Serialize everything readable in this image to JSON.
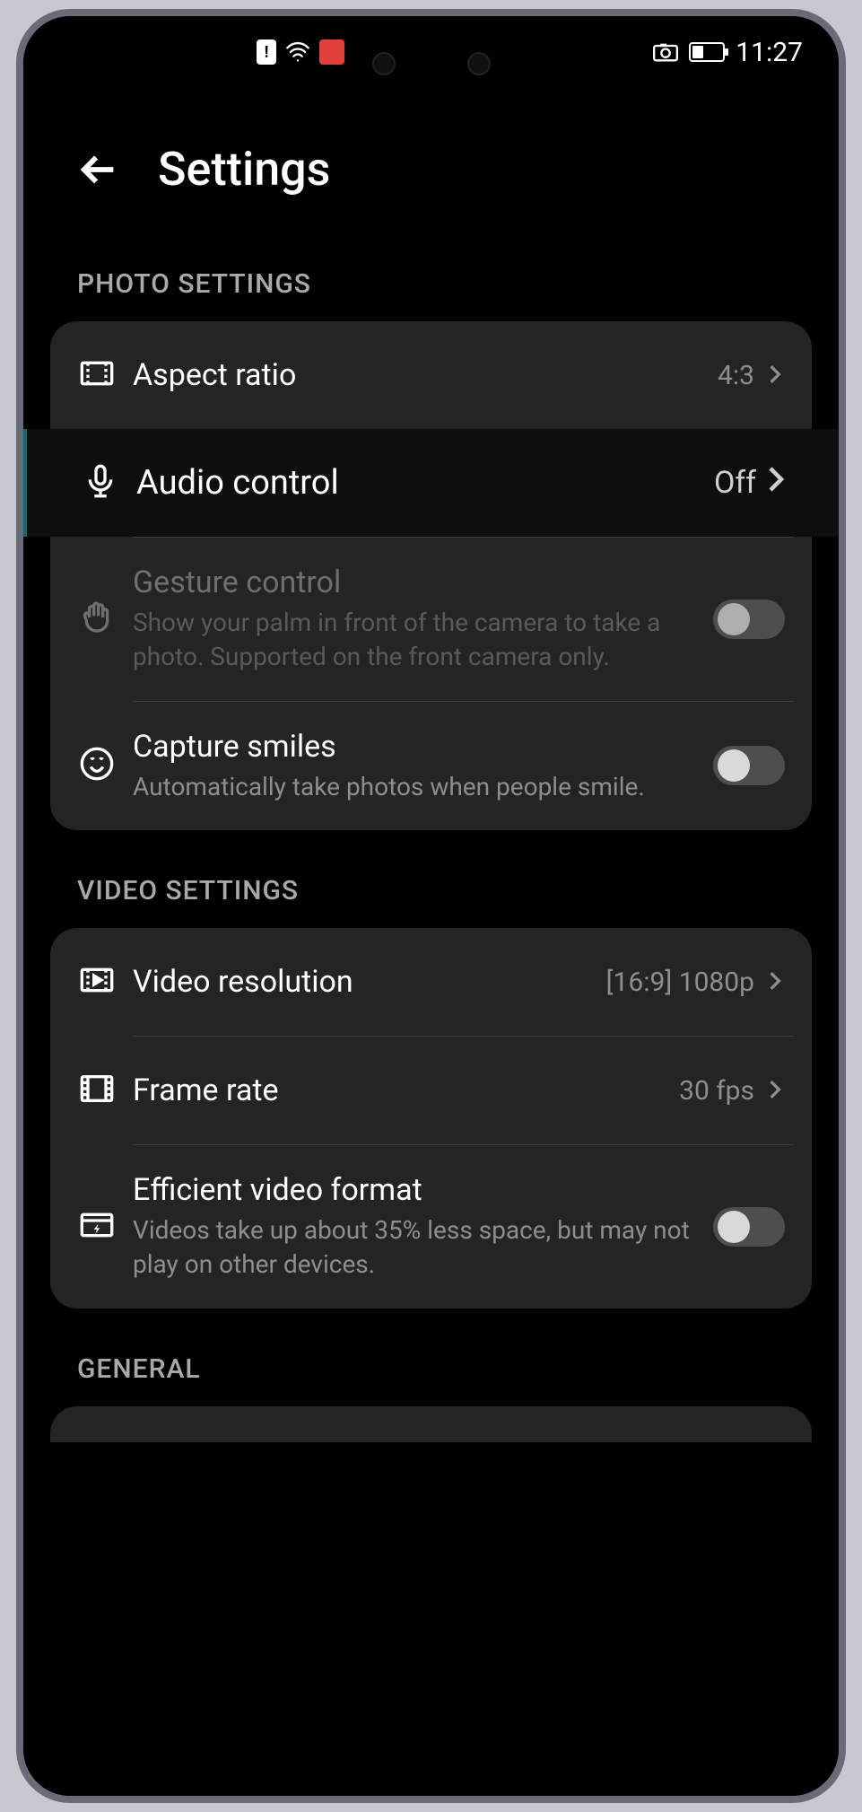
{
  "status": {
    "time": "11:27"
  },
  "header": {
    "title": "Settings"
  },
  "sections": {
    "photo": {
      "header": "PHOTO SETTINGS",
      "aspect_ratio": {
        "label": "Aspect ratio",
        "value": "4:3"
      },
      "audio_control": {
        "label": "Audio control",
        "value": "Off"
      },
      "gesture_control": {
        "label": "Gesture control",
        "desc": "Show your palm in front of the camera to take a photo. Supported on the front camera only."
      },
      "capture_smiles": {
        "label": "Capture smiles",
        "desc": "Automatically take photos when people smile."
      }
    },
    "video": {
      "header": "VIDEO SETTINGS",
      "resolution": {
        "label": "Video resolution",
        "value": "[16:9] 1080p"
      },
      "frame_rate": {
        "label": "Frame rate",
        "value": "30 fps"
      },
      "efficient": {
        "label": "Efficient video format",
        "desc": "Videos take up about 35% less space, but may not play on other devices."
      }
    },
    "general": {
      "header": "GENERAL"
    }
  }
}
